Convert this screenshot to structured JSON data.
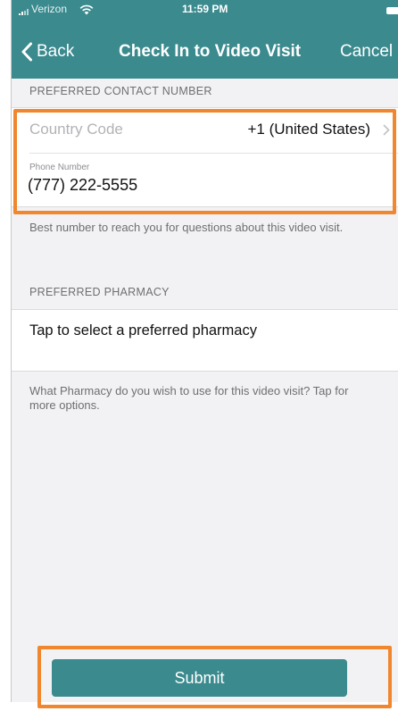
{
  "colors": {
    "accent": "#3a8a8e",
    "highlight": "#f0872e",
    "background": "#f2f2f4"
  },
  "status_bar": {
    "carrier": "Verizon",
    "time": "11:59 PM",
    "signal_icon": "signal-bars-icon",
    "wifi_icon": "wifi-icon",
    "battery_icon": "battery-icon"
  },
  "nav": {
    "back_label": "Back",
    "back_icon": "chevron-left-icon",
    "title": "Check In to Video Visit",
    "cancel_label": "Cancel"
  },
  "contact": {
    "header": "PREFERRED CONTACT NUMBER",
    "country_code_label": "Country Code",
    "country_code_value": "+1 (United States)",
    "chevron_icon": "chevron-right-icon",
    "phone_caption": "Phone Number",
    "phone_value": "(777) 222-5555",
    "footnote": "Best number to reach you for questions about this video visit."
  },
  "pharmacy": {
    "header": "PREFERRED PHARMACY",
    "select_label": "Tap to select a preferred pharmacy",
    "footnote": "What Pharmacy do you wish to use for this video visit? Tap for more options."
  },
  "submit": {
    "label": "Submit"
  }
}
